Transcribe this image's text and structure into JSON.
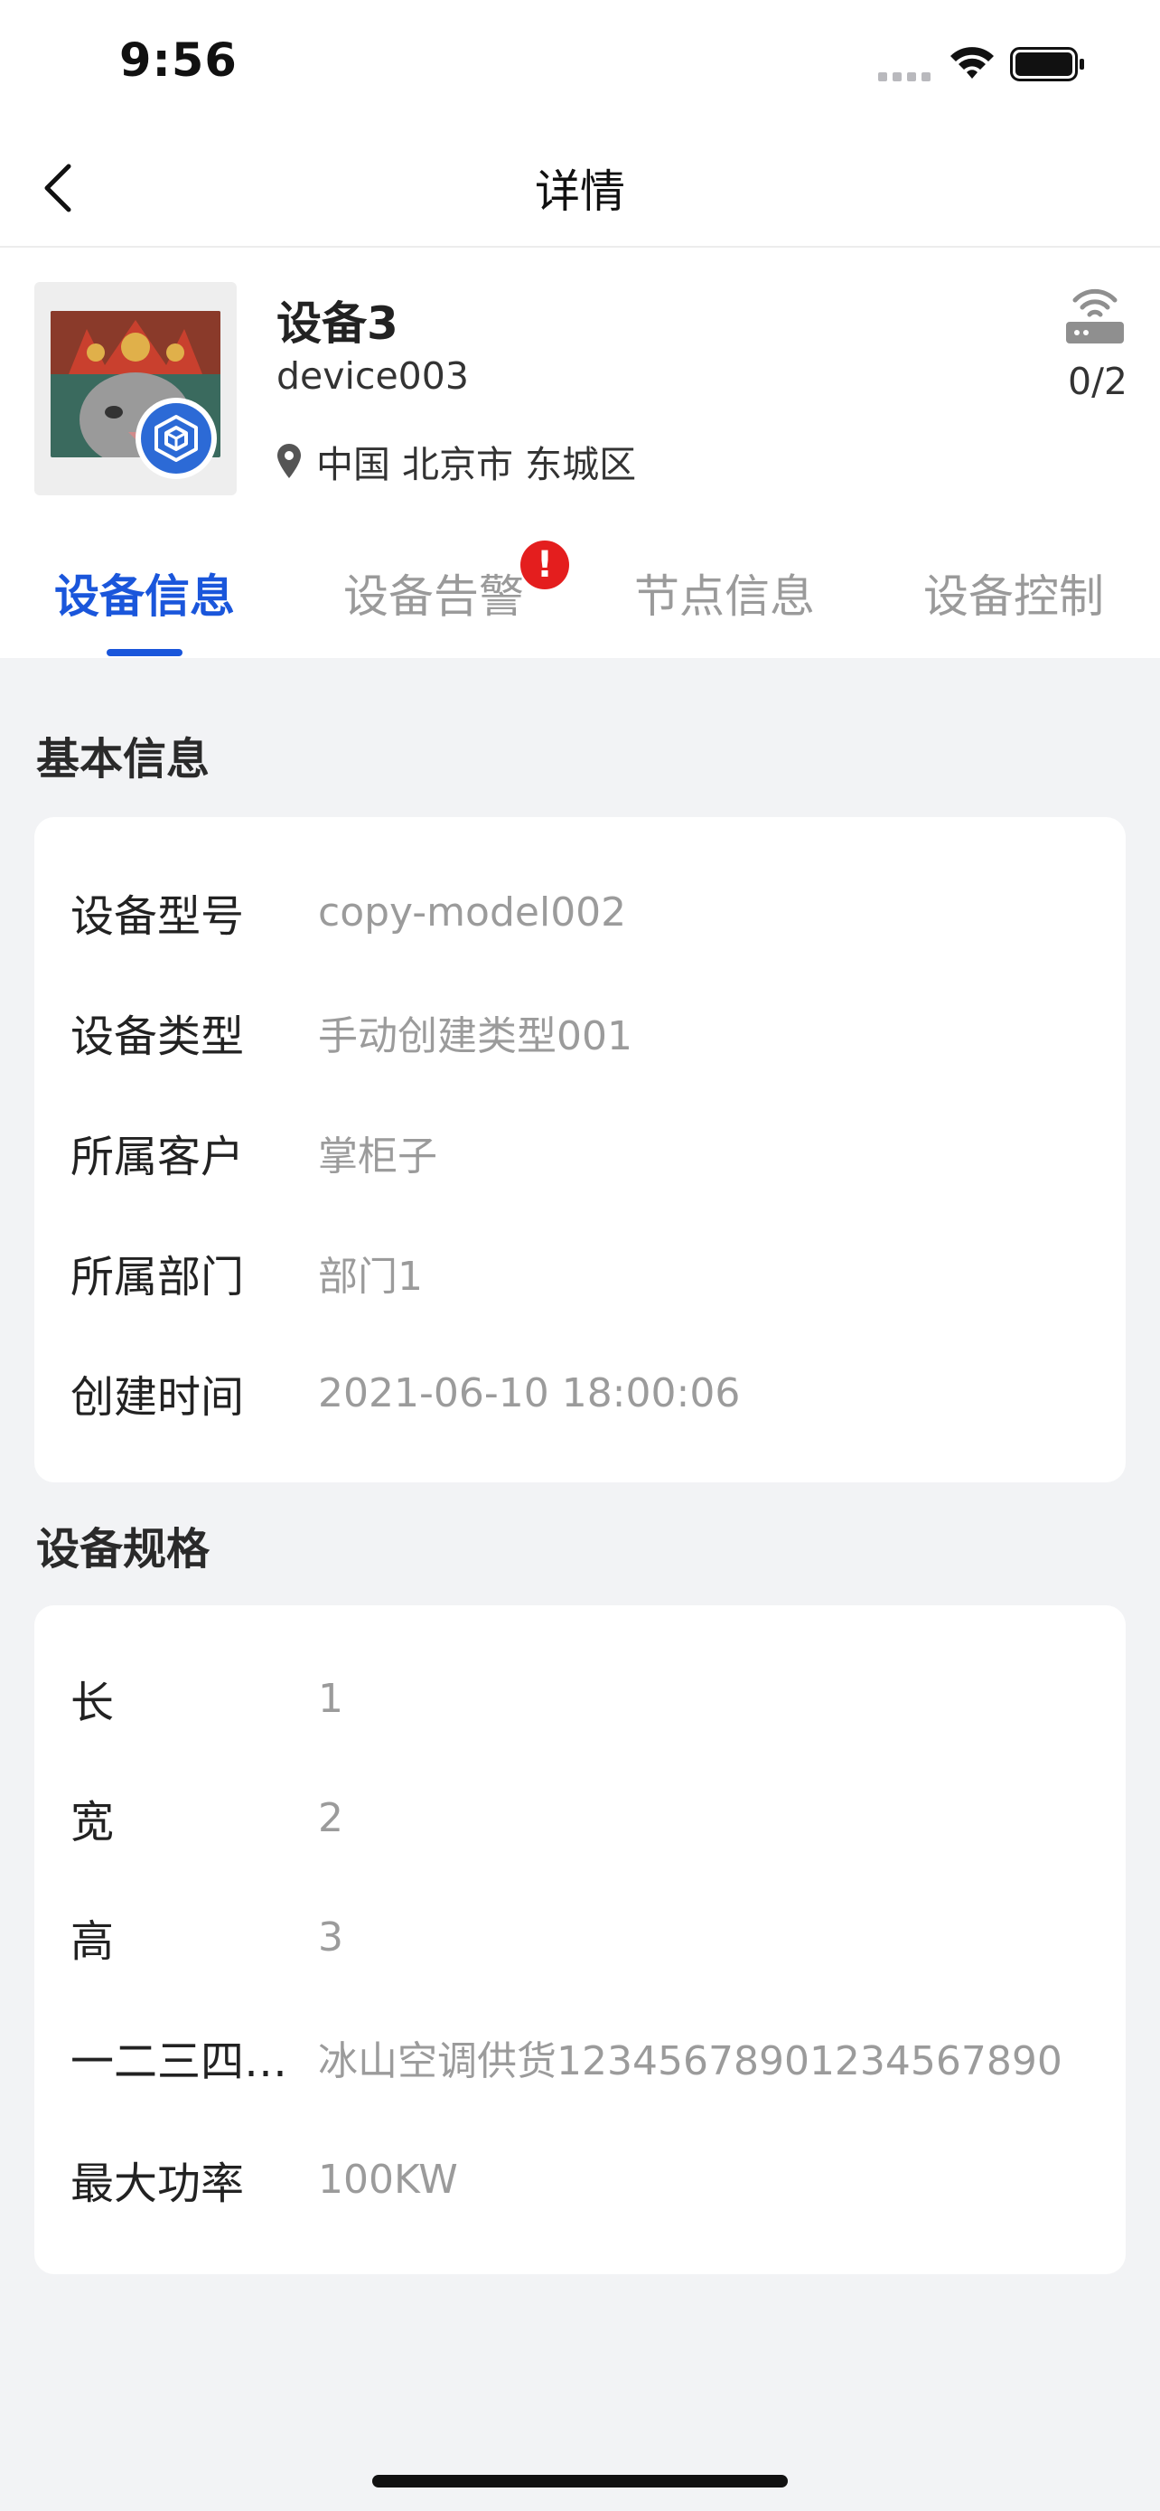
{
  "status_bar": {
    "time": "9:56"
  },
  "nav": {
    "title": "详情"
  },
  "device": {
    "name": "设备3",
    "code": "device003",
    "location": "中国 北京市 东城区",
    "node_count": "0/2"
  },
  "tabs": [
    {
      "label": "设备信息",
      "active": true
    },
    {
      "label": "设备告警",
      "active": false,
      "alert": "!"
    },
    {
      "label": "节点信息",
      "active": false
    },
    {
      "label": "设备控制",
      "active": false
    }
  ],
  "basic_info": {
    "title": "基本信息",
    "rows": [
      {
        "label": "设备型号",
        "value": "copy-model002"
      },
      {
        "label": "设备类型",
        "value": "手动创建类型001"
      },
      {
        "label": "所属客户",
        "value": "掌柜子"
      },
      {
        "label": "所属部门",
        "value": "部门1"
      },
      {
        "label": "创建时间",
        "value": "2021-06-10 18:00:06"
      }
    ]
  },
  "specs": {
    "title": "设备规格",
    "rows": [
      {
        "label": "长",
        "value": "1"
      },
      {
        "label": "宽",
        "value": "2"
      },
      {
        "label": "高",
        "value": "3"
      },
      {
        "label": "一二三四…",
        "value": "冰山空调供货12345678901234567890"
      },
      {
        "label": "最大功率",
        "value": "100KW"
      }
    ]
  },
  "colors": {
    "accent": "#1a56db",
    "alert": "#e41e1e",
    "background": "#f2f3f5",
    "label": "#222222",
    "value": "#9b9b9b"
  }
}
